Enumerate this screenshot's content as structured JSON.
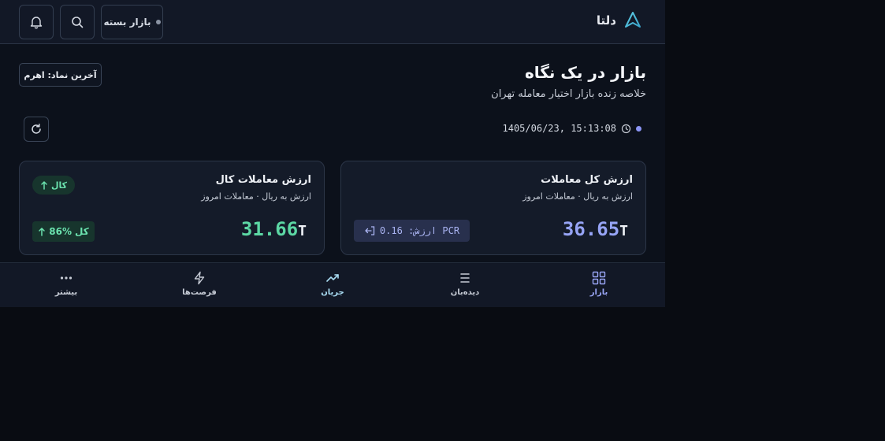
{
  "header": {
    "brand_name": "دلتا",
    "market_status": "بازار بسته",
    "logo_icon": "delta-triangle-icon",
    "search_icon": "search-icon",
    "bell_icon": "bell-icon"
  },
  "overview": {
    "title": "بازار در یک نگاه",
    "subtitle": "خلاصه زنده بازار اختیار معامله تهران",
    "last_symbol": "آخرین نماد: اهرم",
    "timestamp": "1405/06/23, 15:13:08"
  },
  "cards": {
    "total": {
      "title": "ارزش کل معاملات",
      "subtitle": "ارزش به ریال · معاملات امروز",
      "value": "36.65",
      "unit": "T",
      "pcr_label": "PCR ارزش: 0.16"
    },
    "goods": {
      "title": "ارزش معاملات کال",
      "subtitle": "ارزش به ریال · معاملات امروز",
      "value": "31.66",
      "unit": "T",
      "badge": "کال",
      "share_percent": "86%",
      "share_label": "کل"
    }
  },
  "bottom_nav": {
    "items": [
      {
        "label": "بازار",
        "icon": "grid-icon"
      },
      {
        "label": "دیده‌بان",
        "icon": "list-icon"
      },
      {
        "label": "جریان",
        "icon": "trend-up-icon"
      },
      {
        "label": "فرصت‌ها",
        "icon": "lightning-icon"
      },
      {
        "label": "بیشتر",
        "icon": "more-dots-icon"
      }
    ],
    "active": "جریان"
  },
  "colors": {
    "accent_blue": "#96a4f5",
    "accent_green": "#5cd7a4",
    "background": "#0c111b",
    "card_bg": "#141b29"
  }
}
